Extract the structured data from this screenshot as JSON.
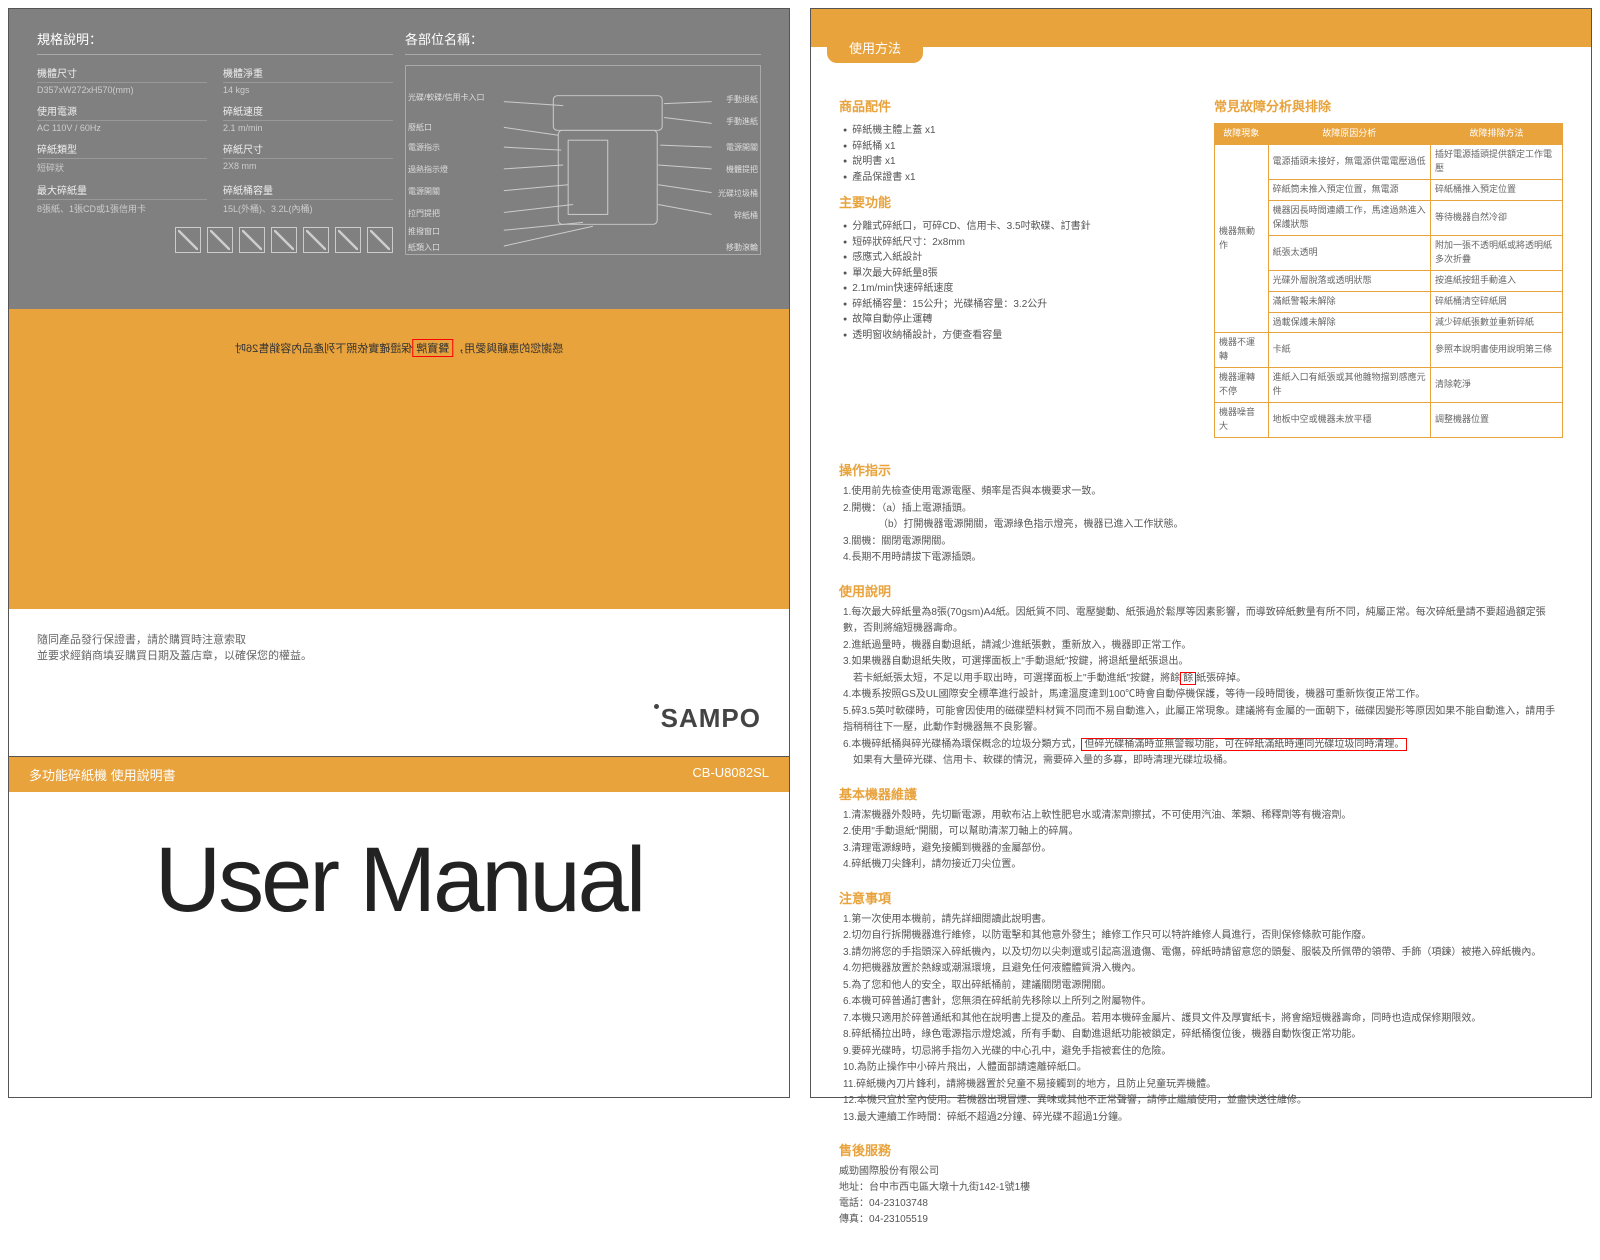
{
  "left": {
    "spec_title": "規格說明：",
    "parts_title": "各部位名稱：",
    "rows": [
      {
        "l1": "機體尺寸",
        "v1": "D357xW272xH570(mm)",
        "l2": "機體淨重",
        "v2": "14 kgs"
      },
      {
        "l1": "使用電源",
        "v1": "AC 110V / 60Hz",
        "l2": "碎紙速度",
        "v2": "2.1 m/min"
      },
      {
        "l1": "碎紙類型",
        "v1": "短碎狀",
        "l2": "碎紙尺寸",
        "v2": "2X8 mm"
      },
      {
        "l1": "最大碎紙量",
        "v1": "8張紙、1張CD或1張信用卡",
        "l2": "碎紙桶容量",
        "v2": "15L(外桶)、3.2L(內桶)"
      }
    ],
    "diag_labels": [
      "光碟/軟碟/信用卡入口",
      "廢紙口",
      "電源指示",
      "過熱指示燈",
      "電源開關",
      "拉門提把",
      "推撥窗口",
      "移動滾輪",
      "手動退紙",
      "手動進紙",
      "電源開關",
      "機體提把",
      "光碟垃圾桶",
      "碎紙桶",
      "紙類入口"
    ],
    "flip_text_a": "感謝您的惠顧與愛用，",
    "flip_box": "聲寶牌",
    "flip_text_b": "保證確實依照下列產品內容銷售26吋",
    "warranty1": "隨同產品發行保證書，請於購買時注意索取",
    "warranty2": "並要求經銷商填妥購買日期及蓋店章，以確保您的權益。",
    "logo": "SAMPO",
    "tab_left": "多功能碎紙機 使用說明書",
    "tab_right": "CB-U8082SL",
    "big": "User Manual"
  },
  "right": {
    "top_tab": "使用方法",
    "sec_accessories": "商品配件",
    "accessories": [
      "碎紙機主體上蓋 x1",
      "碎紙桶 x1",
      "說明書 x1",
      "產品保證書 x1"
    ],
    "sec_features": "主要功能",
    "features": [
      "分離式碎紙口，可碎CD、信用卡、3.5吋軟碟、訂書針",
      "短碎狀碎紙尺寸：2x8mm",
      "感應式入紙設計",
      "單次最大碎紙量8張",
      "2.1m/min快速碎紙速度",
      "碎紙桶容量：15公升；光碟桶容量：3.2公升",
      "故障自動停止運轉",
      "透明窗收納桶設計，方便查看容量"
    ],
    "sec_trouble": "常見故障分析與排除",
    "th": [
      "故障現象",
      "故障原因分析",
      "故障排除方法"
    ],
    "tbl": [
      [
        "機器無動作",
        "電源插頭未接好，無電源供電電壓過低",
        "插好電源插頭提供額定工作電壓"
      ],
      [
        "",
        "碎紙筒未推入預定位置，無電源",
        "碎紙桶推入預定位置"
      ],
      [
        "",
        "機器因長時間連續工作，馬達過熱進入保護狀態",
        "等待機器自然冷卻"
      ],
      [
        "",
        "紙張太透明",
        "附加一張不透明紙或將透明紙多次折疊"
      ],
      [
        "",
        "光碟外層脫落或透明狀態",
        "按進紙按鈕手動進入"
      ],
      [
        "",
        "滿紙警報未解除",
        "碎紙桶清空碎紙屑"
      ],
      [
        "",
        "過載保護未解除",
        "減少碎紙張數並重新碎紙"
      ],
      [
        "機器不運轉",
        "卡紙",
        "參照本說明書使用說明第三條"
      ],
      [
        "機器運轉不停",
        "進紙入口有紙張或其他雜物擋到感應元件",
        "清除乾淨"
      ],
      [
        "機器噪音大",
        "地板中空或機器未放平穩",
        "調整機器位置"
      ]
    ],
    "sec_op": "操作指示",
    "op": [
      "1.使用前先檢查使用電源電壓、頻率是否與本機要求一致。",
      "2.開機：（a）插上電源插頭。",
      "　　　　（b）打開機器電源開關，電源綠色指示燈亮，機器已進入工作狀態。",
      "3.關機：關閉電源開關。",
      "4.長期不用時請拔下電源插頭。"
    ],
    "sec_use": "使用說明",
    "use": [
      "1.每次最大碎紙量為8張(70gsm)A4紙。因紙質不同、電壓變動、紙張過於鬆厚等因素影響，而導致碎紙數量有所不同，純屬正常。每次碎紙量請不要超過額定張數，否則將縮短機器壽命。",
      "2.進紙過量時，機器自動退紙，請減少進紙張數，重新放入，機器即正常工作。",
      "3.如果機器自動退紙失敗，可選擇面板上\"手動退紙\"按鍵，將退紙量紙張退出。",
      "　若卡紙紙張太短，不足以用手取出時，可選擇面板上\"手動進紙\"按鍵，將餘",
      "4.本機系按照GS及UL國際安全標準進行設計，馬達溫度達到100℃時會自動停機保護，等待一段時間後，機器可重新恢復正常工作。",
      "5.碎3.5英吋軟碟時，可能會因使用的磁碟塑料材質不同而不易自動進入，此屬正常現象。建議將有金屬的一面朝下，磁碟因變形等原因如果不能自動進入，請用手指稍稍往下一壓，此動作對機器無不良影響。",
      "6.本機碎紙桶與碎光碟桶為環保概念的垃圾分類方式，",
      "　如果有大量碎光碟、信用卡、軟碟的情況，需要碎入量的多寡，即時清理光碟垃圾桶。"
    ],
    "redbox_use3": "餘",
    "redbox_use3b": "紙張碎掉。",
    "redbox_use6": "但碎光碟桶滿時並無警報功能，可在碎紙滿紙時連同光碟垃圾同時清理。",
    "sec_maint": "基本機器維護",
    "maint": [
      "1.清潔機器外殼時，先切斷電源，用軟布沾上軟性肥皂水或清潔劑擦拭，不可使用汽油、苯類、稀釋劑等有機溶劑。",
      "2.使用\"手動退紙\"開關，可以幫助清潔刀軸上的碎屑。",
      "3.清理電源線時，避免接觸到機器的金屬部份。",
      "4.碎紙機刀尖鋒利，請勿接近刀尖位置。"
    ],
    "sec_caution": "注意事項",
    "cau": [
      "1.第一次使用本機前，請先詳細閱讀此說明書。",
      "2.切勿自行拆開機器進行維修，以防電擊和其他意外發生；維修工作只可以特許維修人員進行，否則保修條款可能作廢。",
      "3.請勿將您的手指頭深入碎紙機內，以及切勿以尖刺還或引起高溫遺傷、電傷，碎紙時請留意您的頭髮、服裝及所佩帶的領帶、手飾（項鍊）被捲入碎紙機內。",
      "4.勿把機器放置於熱線或潮濕環境，且避免任何液體體質滑入機內。",
      "5.為了您和他人的安全，取出碎紙桶前，建議關閉電源開關。",
      "6.本機可碎普通訂書針，您無須在碎紙前先移除以上所列之附屬物件。",
      "7.本機只適用於碎普通紙和其他在說明書上提及的產品。若用本機碎金屬片、護貝文件及厚實紙卡，將會縮短機器壽命，同時也造成保修期限效。",
      "8.碎紙桶拉出時，綠色電源指示燈熄滅，所有手動、自動進退紙功能被鎖定，碎紙桶復位後，機器自動恢復正常功能。",
      "9.要碎光碟時，切忌將手指勿入光碟的中心孔中，避免手指被套住的危險。",
      "10.為防止操作中小碎片飛出，人體面部請遠離碎紙口。",
      "11.碎紙機內刀片鋒利，請將機器置於兒童不易接觸到的地方，且防止兒童玩弄機體。",
      "12.本機只宜於室內使用。若機器出現冒煙、異味或其他不正常聲響，請停止繼續使用，並盡快送往維修。",
      "13.最大連續工作時間：碎紙不超過2分鐘、碎光碟不超過1分鐘。"
    ],
    "sec_service": "售後服務",
    "company": "威勁國際股份有限公司",
    "address": "地址：台中市西屯區大墩十九街142-1號1樓",
    "tel": "電話：04-23103748",
    "fax": "傳真：04-23105519"
  }
}
